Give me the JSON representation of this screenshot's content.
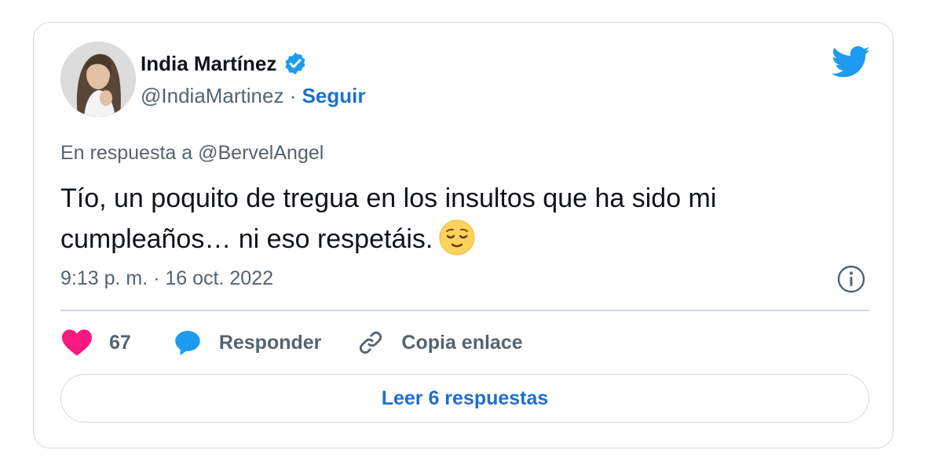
{
  "author": {
    "display_name": "India Martínez",
    "handle": "@IndiaMartinez",
    "separator": " · ",
    "follow_label": "Seguir"
  },
  "tweet": {
    "reply_prefix": "En respuesta a ",
    "reply_handle": "@BervelAngel",
    "text": "Tío, un poquito de tregua en los insultos que ha sido mi cumpleaños… ni eso respetáis.",
    "timestamp": "9:13 p. m. · 16 oct. 2022"
  },
  "actions": {
    "like_count": "67",
    "reply_label": "Responder",
    "copy_link_label": "Copia enlace",
    "read_replies_label": "Leer 6 respuestas"
  },
  "colors": {
    "accent": "#1d6fd0",
    "like": "#f91880",
    "reply_bubble": "#1d9bf0",
    "muted_text": "#536471",
    "border": "#cfd9de"
  },
  "icons": [
    "avatar",
    "verified-badge-icon",
    "twitter-bird-icon",
    "relieved-face-emoji",
    "info-icon",
    "heart-icon",
    "reply-bubble-icon",
    "link-icon"
  ]
}
